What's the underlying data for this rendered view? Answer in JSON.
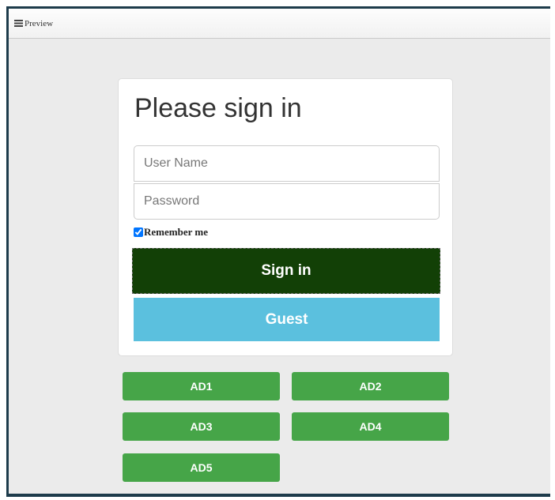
{
  "window": {
    "title": "Preview",
    "menu_icon": "hamburger-menu-icon"
  },
  "login": {
    "heading": "Please sign in",
    "username": {
      "placeholder": "User Name",
      "value": ""
    },
    "password": {
      "placeholder": "Password",
      "value": ""
    },
    "remember": {
      "label": "Remember me",
      "checked": true
    },
    "sign_in_label": "Sign in",
    "guest_label": "Guest"
  },
  "ads": [
    "AD1",
    "AD2",
    "AD3",
    "AD4",
    "AD5"
  ],
  "colors": {
    "sign_in_bg": "#124006",
    "guest_bg": "#5bc0de",
    "ad_bg": "#46a548",
    "frame": "#1d3b4b"
  }
}
